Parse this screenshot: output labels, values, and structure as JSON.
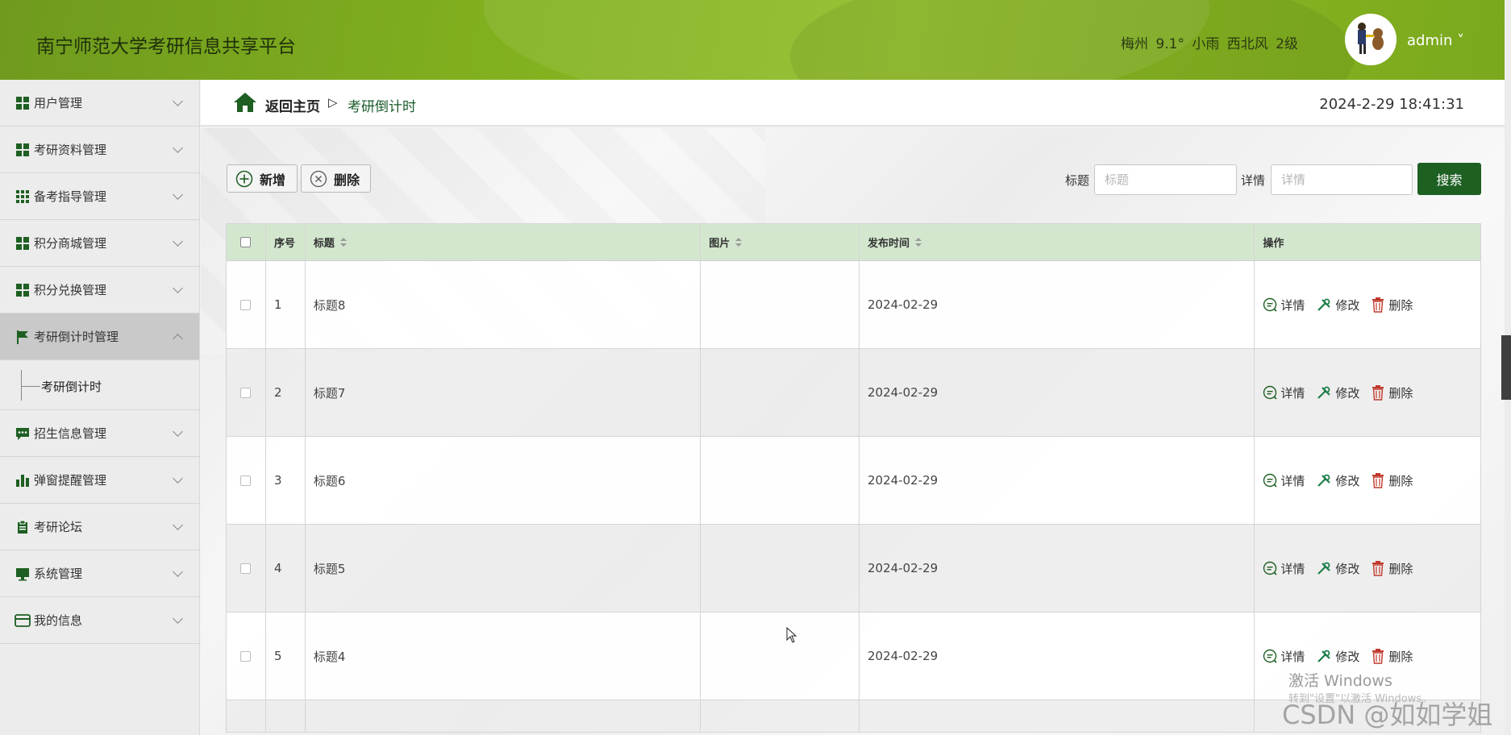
{
  "header": {
    "title": "南宁师范大学考研信息共享平台",
    "weather": "梅州 9.1° 小雨 西北风 2级",
    "username": "admin ˅"
  },
  "sidebar": {
    "items": [
      {
        "label": "用户管理",
        "icon": "grid-icon"
      },
      {
        "label": "考研资料管理",
        "icon": "grid-icon"
      },
      {
        "label": "备考指导管理",
        "icon": "grid9-icon"
      },
      {
        "label": "积分商城管理",
        "icon": "grid-icon"
      },
      {
        "label": "积分兑换管理",
        "icon": "grid-icon"
      },
      {
        "label": "考研倒计时管理",
        "icon": "flag-icon",
        "active": true
      },
      {
        "label": "招生信息管理",
        "icon": "chat-icon"
      },
      {
        "label": "弹窗提醒管理",
        "icon": "bar-chart-icon"
      },
      {
        "label": "考研论坛",
        "icon": "clipboard-icon"
      },
      {
        "label": "系统管理",
        "icon": "monitor-icon"
      },
      {
        "label": "我的信息",
        "icon": "card-icon"
      }
    ],
    "submenu_label": "考研倒计时"
  },
  "breadcrumb": {
    "home": "返回主页",
    "separator": "▷",
    "current": "考研倒计时"
  },
  "datetime": "2024-2-29 18:41:31",
  "toolbar": {
    "add_label": "新增",
    "delete_label": "删除"
  },
  "search": {
    "title_label": "标题",
    "title_placeholder": "标题",
    "detail_label": "详情",
    "detail_placeholder": "详情",
    "button_label": "搜索"
  },
  "table": {
    "headers": [
      "序号",
      "标题",
      "图片",
      "发布时间",
      "操作"
    ],
    "rows": [
      {
        "index": "1",
        "title": "标题8",
        "image": "",
        "date": "2024-02-29"
      },
      {
        "index": "2",
        "title": "标题7",
        "image": "",
        "date": "2024-02-29"
      },
      {
        "index": "3",
        "title": "标题6",
        "image": "",
        "date": "2024-02-29"
      },
      {
        "index": "4",
        "title": "标题5",
        "image": "",
        "date": "2024-02-29"
      },
      {
        "index": "5",
        "title": "标题4",
        "image": "",
        "date": "2024-02-29"
      }
    ],
    "actions": {
      "detail": "详情",
      "edit": "修改",
      "delete": "删除"
    }
  },
  "overlay": {
    "activate_windows": "激活 Windows",
    "activate_sub": "转到\"设置\"以激活 Windows。",
    "watermark": "CSDN @如如学姐"
  },
  "colors": {
    "header_green": "#82b11f",
    "accent_dark_green": "#1e5f22",
    "table_header": "#d3e7cf",
    "delete_red": "#c0392b"
  }
}
